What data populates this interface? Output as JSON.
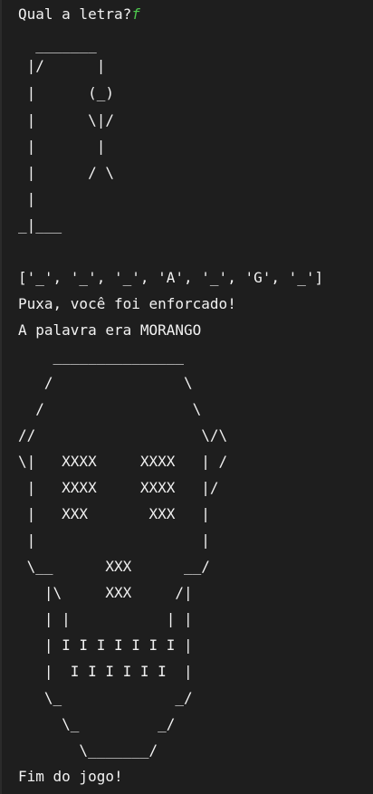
{
  "prompt": {
    "label": "Qual a letra?",
    "input_value": "f"
  },
  "gallows": [
    "  _______",
    " |/      |",
    " |      (_)",
    " |      \\|/",
    " |       |",
    " |      / \\",
    " |",
    "_|___"
  ],
  "board": "['_', '_', '_', 'A', '_', 'G', '_']",
  "lose_message": "Puxa, você foi enforcado!",
  "word_reveal": "A palavra era MORANGO",
  "skull": [
    "    _______________",
    "   /               \\",
    "  /                 \\",
    "//                   \\/\\",
    "\\|   XXXX     XXXX   | /",
    " |   XXXX     XXXX   |/",
    " |   XXX       XXX   |",
    " |                   |",
    " \\__      XXX      __/",
    "   |\\     XXX     /|",
    "   | |           | |",
    "   | I I I I I I I |",
    "   |  I I I I I I  |",
    "   \\_             _/",
    "     \\_         _/",
    "       \\_______/"
  ],
  "game_over": "Fim do jogo!"
}
